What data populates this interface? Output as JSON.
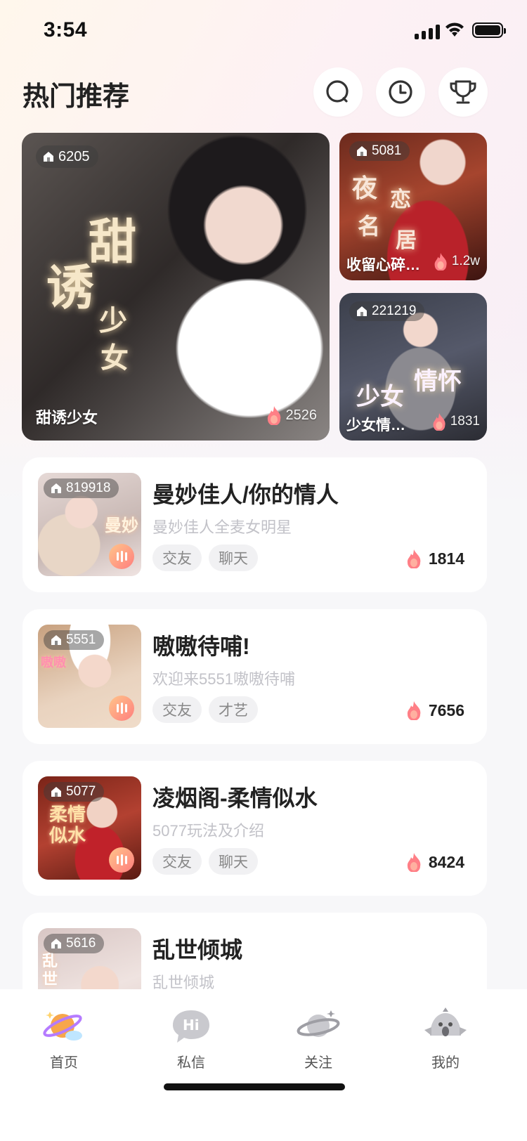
{
  "status_bar": {
    "time": "3:54"
  },
  "header": {
    "title": "热门推荐",
    "icons": [
      "search-icon",
      "history-clock-icon",
      "trophy-icon"
    ]
  },
  "featured": [
    {
      "room_id": "6205",
      "title": "甜诱少女",
      "heat": "2526",
      "art_text": [
        "甜",
        "诱",
        "少",
        "女"
      ]
    },
    {
      "room_id": "5081",
      "title": "收留心碎…",
      "heat": "1.2w",
      "art_text": [
        "夜",
        "恋",
        "名",
        "居"
      ]
    },
    {
      "room_id": "221219",
      "title": "少女情…",
      "heat": "1831",
      "art_text": [
        "少女",
        "情怀"
      ]
    }
  ],
  "rooms": [
    {
      "room_id": "819918",
      "title": "曼妙佳人/你的情人",
      "subtitle": "曼妙佳人全麦女明星",
      "tags": [
        "交友",
        "聊天"
      ],
      "heat": "1814",
      "art_text": "曼妙"
    },
    {
      "room_id": "5551",
      "title": "嗷嗷待哺!",
      "subtitle": "欢迎来5551嗷嗷待哺",
      "tags": [
        "交友",
        "才艺"
      ],
      "heat": "7656",
      "art_text": "嗷嗷"
    },
    {
      "room_id": "5077",
      "title": "凌烟阁-柔情似水",
      "subtitle": "5077玩法及介绍",
      "tags": [
        "交友",
        "聊天"
      ],
      "heat": "8424",
      "art_text": "柔情似水"
    },
    {
      "room_id": "5616",
      "title": "乱世倾城",
      "subtitle": "乱世倾城",
      "tags": [],
      "heat": "",
      "art_text": "乱世"
    }
  ],
  "nav": [
    {
      "label": "首页",
      "icon": "home-planet-icon",
      "active": true
    },
    {
      "label": "私信",
      "icon": "hi-chat-icon",
      "active": false
    },
    {
      "label": "关注",
      "icon": "planet-follow-icon",
      "active": false
    },
    {
      "label": "我的",
      "icon": "bird-profile-icon",
      "active": false
    }
  ],
  "colors": {
    "accent_flame": "#ff7f86",
    "live_badge": "#ff8f7e",
    "text_primary": "#222222",
    "text_secondary": "#c2c2c8"
  }
}
